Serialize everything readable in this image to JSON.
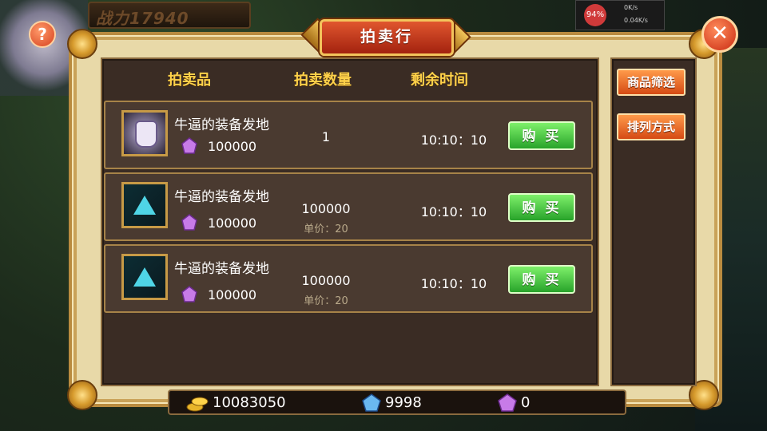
{
  "hud": {
    "power": "战力17940",
    "percent": "94%",
    "speed_up": "0K/s",
    "speed_down": "0.04K/s"
  },
  "title": "拍卖行",
  "help_label": "?",
  "close_label": "✕",
  "headers": {
    "item": "拍卖品",
    "quantity": "拍卖数量",
    "time_left": "剩余时间"
  },
  "rows": [
    {
      "name": "牛逼的装备发地",
      "thumb": "armor-icon",
      "price": "100000",
      "quantity": "1",
      "unit_price": "",
      "time": "10:10：10",
      "buy_label": "购 买"
    },
    {
      "name": "牛逼的装备发地",
      "thumb": "crystal-shard-icon",
      "price": "100000",
      "quantity": "100000",
      "unit_price": "单价：20",
      "time": "10:10：10",
      "buy_label": "购 买"
    },
    {
      "name": "牛逼的装备发地",
      "thumb": "crystal-shard-icon",
      "price": "100000",
      "quantity": "100000",
      "unit_price": "单价：20",
      "time": "10:10：10",
      "buy_label": "购 买"
    }
  ],
  "side": {
    "filter_label": "商品筛选",
    "sort_label": "排列方式"
  },
  "currency": {
    "gold": "10083050",
    "blue_gem": "9998",
    "purple_gem": "0"
  },
  "colors": {
    "header": "#ffd24a",
    "buy_button": "#3fc93a",
    "side_button": "#e8631f",
    "title_plate": "#c23a1a"
  }
}
